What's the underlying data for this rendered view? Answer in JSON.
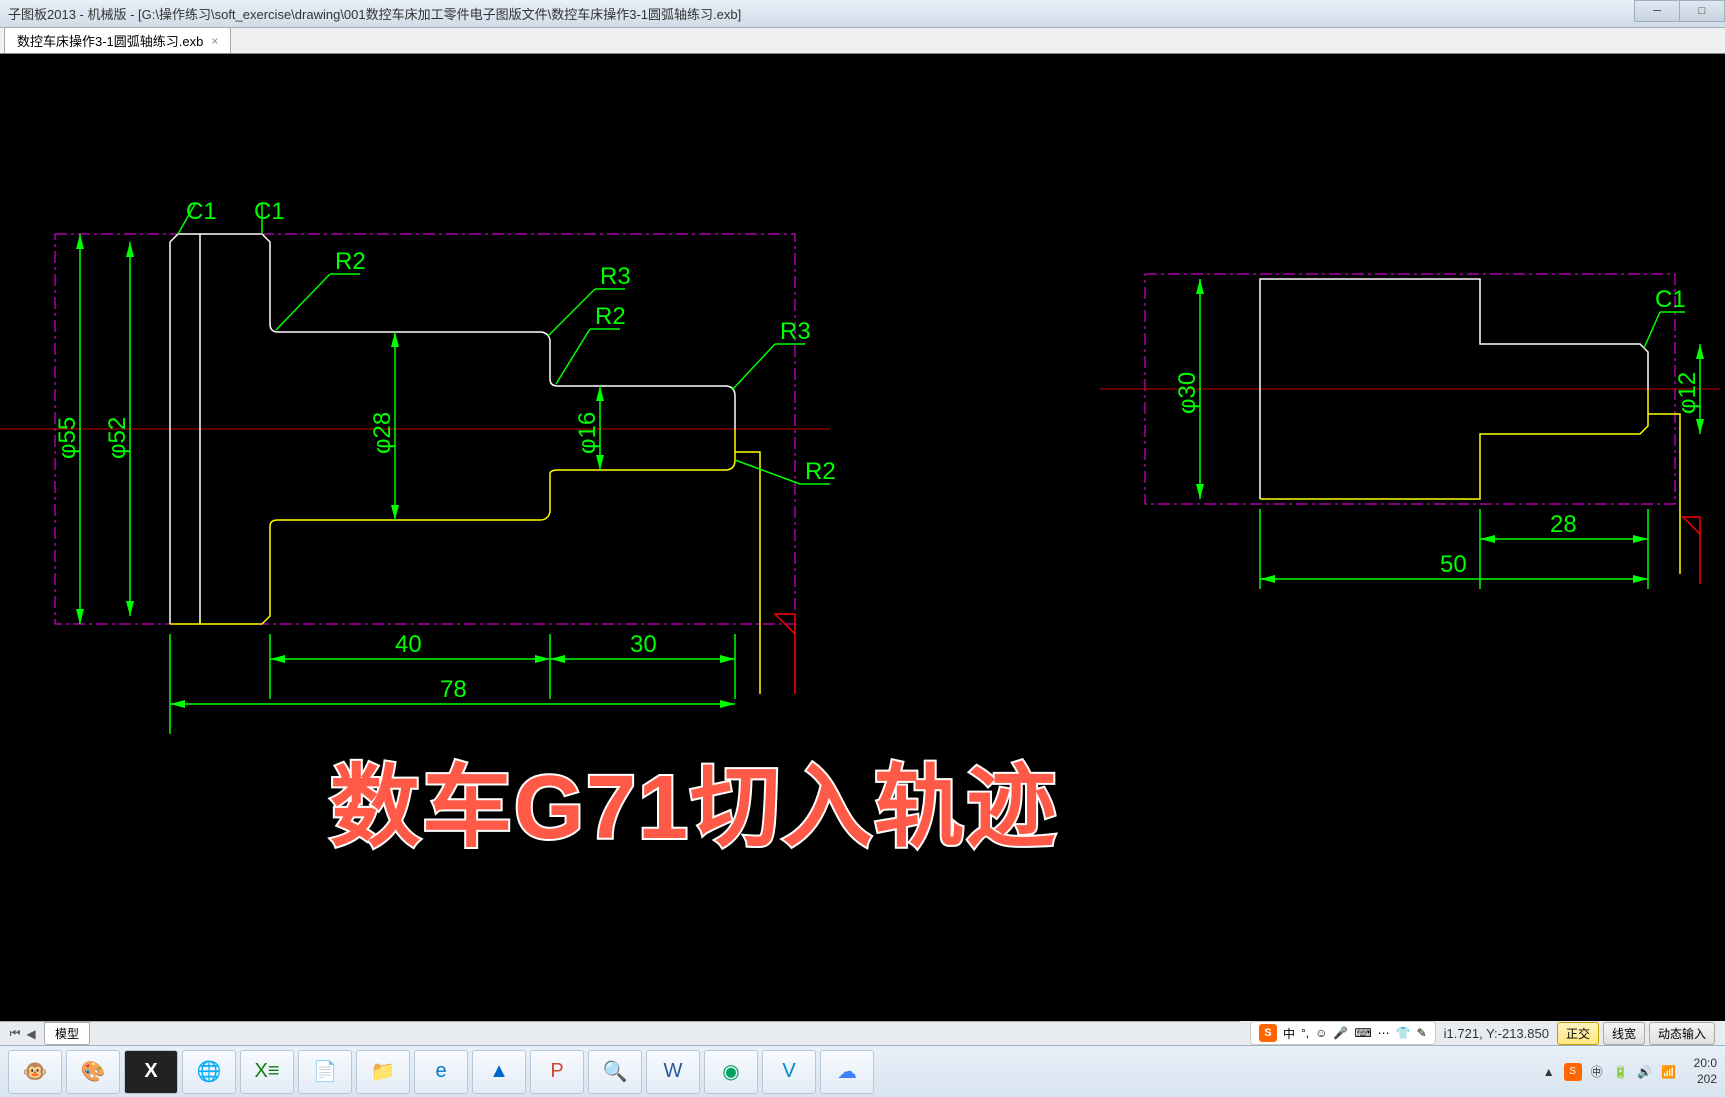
{
  "titlebar": {
    "text": "子图板2013 - 机械版 - [G:\\操作练习\\soft_exercise\\drawing\\001数控车床加工零件电子图版文件\\数控车床操作3-1圆弧轴练习.exb]"
  },
  "tab": {
    "label": "数控车床操作3-1圆弧轴练习.exb"
  },
  "drawing": {
    "left": {
      "chamfers": [
        "C1",
        "C1"
      ],
      "radii": [
        "R2",
        "R3",
        "R2",
        "R3",
        "R2"
      ],
      "diameters": [
        "φ55",
        "φ52",
        "φ28",
        "φ16"
      ],
      "lengths": [
        "40",
        "30",
        "78"
      ]
    },
    "right": {
      "chamfer": "C1",
      "diameters": [
        "φ30",
        "φ12"
      ],
      "lengths": [
        "28",
        "50"
      ]
    }
  },
  "overlay": "数车G71切入轨迹",
  "bottom_tab": "模型",
  "ime": {
    "icon": "S",
    "lang": "中"
  },
  "coords": "i1.721, Y:-213.850",
  "status_buttons": [
    "正交",
    "线宽",
    "动态输入"
  ],
  "clock": {
    "time": "20:0",
    "date": "202"
  }
}
